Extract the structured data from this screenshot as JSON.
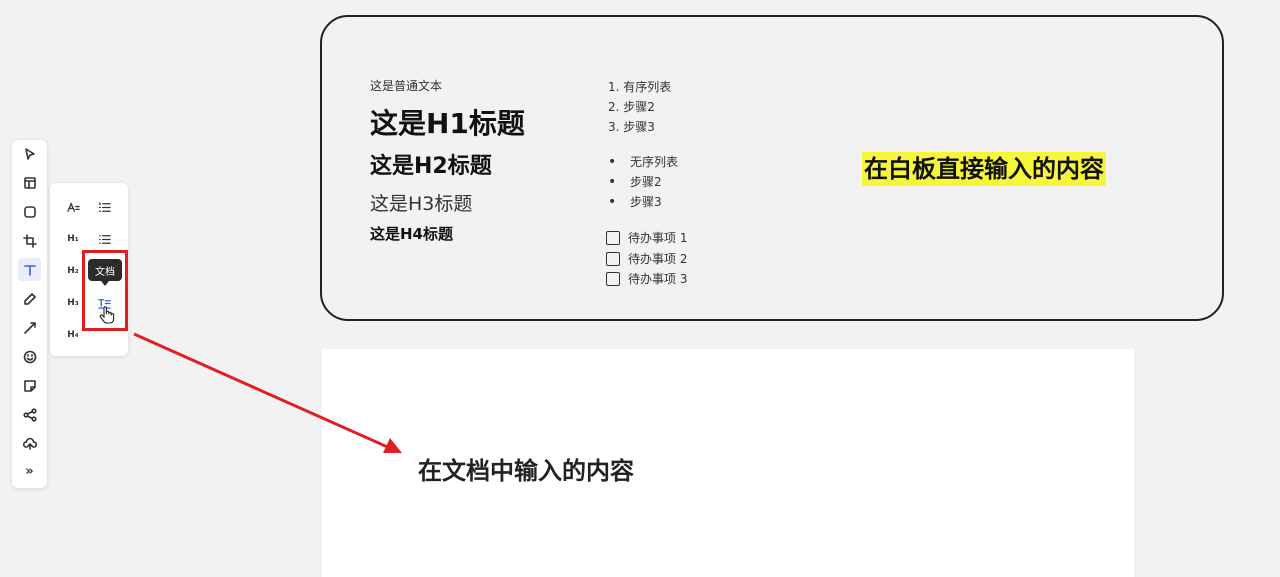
{
  "toolbar": {
    "tools": [
      "select-icon",
      "frame-icon",
      "shape-icon",
      "crop-icon",
      "text-icon",
      "pen-icon",
      "connector-icon",
      "emoji-icon",
      "sticky-note-icon",
      "mindmap-icon",
      "upload-icon",
      "more-icon"
    ],
    "active": "text-icon",
    "more_label": "»"
  },
  "text_panel": {
    "h1": "H₁",
    "h2": "H₂",
    "h3": "H₃",
    "h4": "H₄",
    "tooltip": "文档"
  },
  "whiteboard": {
    "plain_text": "这是普通文本",
    "h1": "这是H1标题",
    "h2": "这是H2标题",
    "h3": "这是H3标题",
    "h4": "这是H4标题",
    "ordered_list": [
      "1.  有序列表",
      "2.  步骤2",
      "3.  步骤3"
    ],
    "unordered_list": [
      "无序列表",
      "步骤2",
      "步骤3"
    ],
    "todo_list": [
      "待办事项 1",
      "待办事项 2",
      "待办事项 3"
    ],
    "highlight_text": "在白板直接输入的内容",
    "highlight_color": "#f7f63b"
  },
  "document": {
    "text": "在文档中输入的内容"
  },
  "annotation": {
    "color": "#e02020"
  }
}
